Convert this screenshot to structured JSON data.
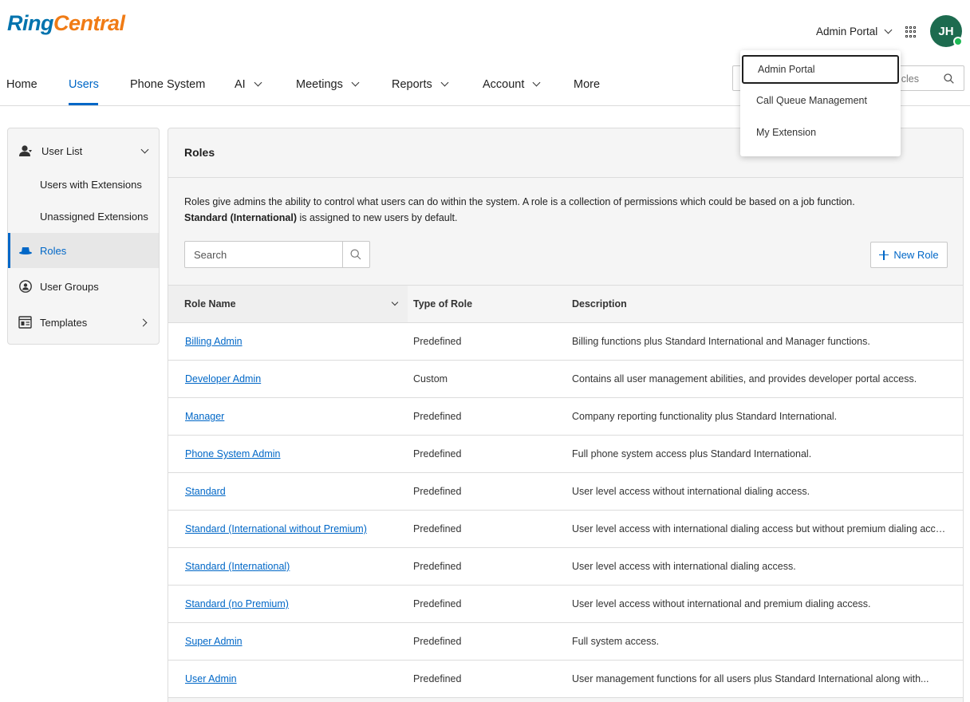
{
  "brand": {
    "ring": "Ring",
    "central": "Central"
  },
  "header": {
    "portal_label": "Admin Portal",
    "avatar_initials": "JH",
    "apps_icon": "grid-icon",
    "presence_color": "#1db954"
  },
  "nav": {
    "items": [
      {
        "label": "Home"
      },
      {
        "label": "Users"
      },
      {
        "label": "Phone System"
      },
      {
        "label": "AI"
      },
      {
        "label": "Meetings"
      },
      {
        "label": "Reports"
      },
      {
        "label": "Account"
      },
      {
        "label": "More"
      }
    ],
    "search_visible_text": "icles"
  },
  "portal_menu": {
    "items": [
      {
        "label": "Admin Portal"
      },
      {
        "label": "Call Queue Management"
      },
      {
        "label": "My Extension"
      }
    ]
  },
  "sidebar": {
    "items": [
      {
        "label": "User List"
      },
      {
        "label": "Users with Extensions"
      },
      {
        "label": "Unassigned Extensions"
      },
      {
        "label": "Roles"
      },
      {
        "label": "User Groups"
      },
      {
        "label": "Templates"
      }
    ]
  },
  "main": {
    "title": "Roles",
    "description_line1": "Roles give admins the ability to control what users can do within the system. A role is a collection of permissions which could be based on a job function.",
    "description_bold": "Standard (International)",
    "description_rest": " is assigned to new users by default.",
    "search_placeholder": "Search",
    "new_role_label": "New Role"
  },
  "table": {
    "columns": [
      "Role Name",
      "Type of Role",
      "Description"
    ],
    "rows": [
      {
        "name": "Billing Admin",
        "type": "Predefined",
        "description": "Billing functions plus Standard International and Manager functions."
      },
      {
        "name": "Developer Admin",
        "type": "Custom",
        "description": "Contains all user management abilities, and provides developer portal access."
      },
      {
        "name": "Manager",
        "type": "Predefined",
        "description": "Company reporting functionality plus Standard International."
      },
      {
        "name": "Phone System Admin",
        "type": "Predefined",
        "description": "Full phone system access plus Standard International."
      },
      {
        "name": "Standard",
        "type": "Predefined",
        "description": "User level access without international dialing access."
      },
      {
        "name": "Standard (International without Premium)",
        "type": "Predefined",
        "description": "User level access with international dialing access but without premium dialing access."
      },
      {
        "name": "Standard (International)",
        "type": "Predefined",
        "description": "User level access with international dialing access."
      },
      {
        "name": "Standard (no Premium)",
        "type": "Predefined",
        "description": "User level access without international and premium dialing access."
      },
      {
        "name": "Super Admin",
        "type": "Predefined",
        "description": "Full system access."
      },
      {
        "name": "User Admin",
        "type": "Predefined",
        "description": "User management functions for all users plus Standard International along with..."
      }
    ]
  },
  "colors": {
    "accent": "#0067c7",
    "brand_blue": "#0073ae",
    "brand_orange": "#f07b15",
    "avatar_bg": "#1d6b4f"
  }
}
